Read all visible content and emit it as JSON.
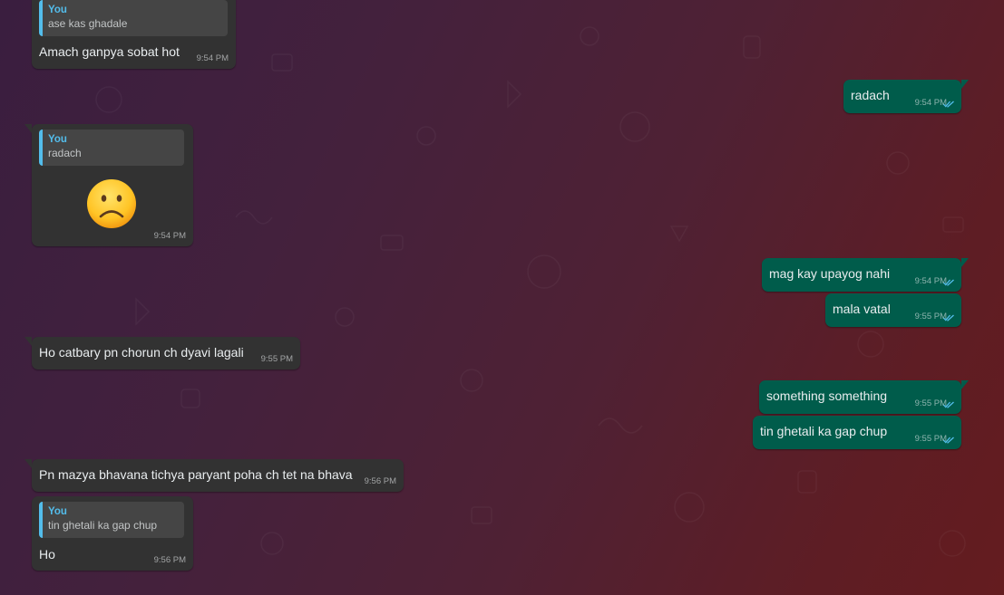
{
  "chat": {
    "messages": [
      {
        "direction": "in",
        "quote_author": "You",
        "quote_text": "ase kas ghadale",
        "text": "Amach ganpya sobat hot",
        "time": "9:54 PM"
      },
      {
        "direction": "out",
        "text": "radach",
        "time": "9:54 PM",
        "status": "read"
      },
      {
        "direction": "in",
        "quote_author": "You",
        "quote_text": "radach",
        "emoji": "☹",
        "emoji_name": "frowning-face",
        "time": "9:54 PM"
      },
      {
        "direction": "out",
        "text": "mag kay upayog nahi",
        "time": "9:54 PM",
        "status": "read"
      },
      {
        "direction": "out",
        "text": "mala vatal",
        "time": "9:55 PM",
        "status": "read"
      },
      {
        "direction": "in",
        "text": "Ho catbary pn chorun ch dyavi lagali",
        "time": "9:55 PM"
      },
      {
        "direction": "out",
        "text": "something something",
        "time": "9:55 PM",
        "status": "read"
      },
      {
        "direction": "out",
        "text": "tin ghetali ka gap chup",
        "time": "9:55 PM",
        "status": "read"
      },
      {
        "direction": "in",
        "text": "Pn mazya bhavana tichya paryant poha ch tet na bhava",
        "time": "9:56 PM"
      },
      {
        "direction": "in",
        "quote_author": "You",
        "quote_text": "tin ghetali ka gap chup",
        "text": "Ho",
        "time": "9:56 PM"
      }
    ]
  },
  "colors": {
    "incoming_bubble": "#323232",
    "outgoing_bubble": "#005c4b",
    "quote_accent": "#53bdeb",
    "read_ticks": "#53bdeb"
  },
  "icons": {
    "read_receipt": "double-check-icon",
    "emoji": "frowning-face-icon"
  }
}
